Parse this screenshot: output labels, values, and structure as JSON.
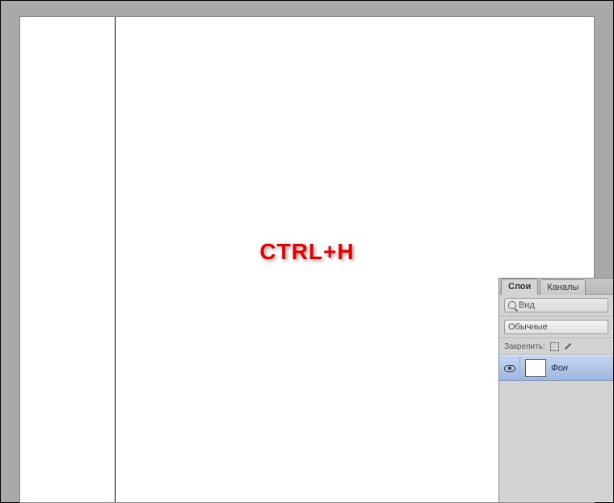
{
  "canvas": {
    "shortcut_overlay": "CTRL+H"
  },
  "panel": {
    "tabs": {
      "layers": "Слои",
      "channels": "Каналы"
    },
    "search": {
      "label": "Вид"
    },
    "blend_mode": "Обычные",
    "lock_label": "Закрепить:",
    "layers": [
      {
        "name": "Фон"
      }
    ]
  }
}
